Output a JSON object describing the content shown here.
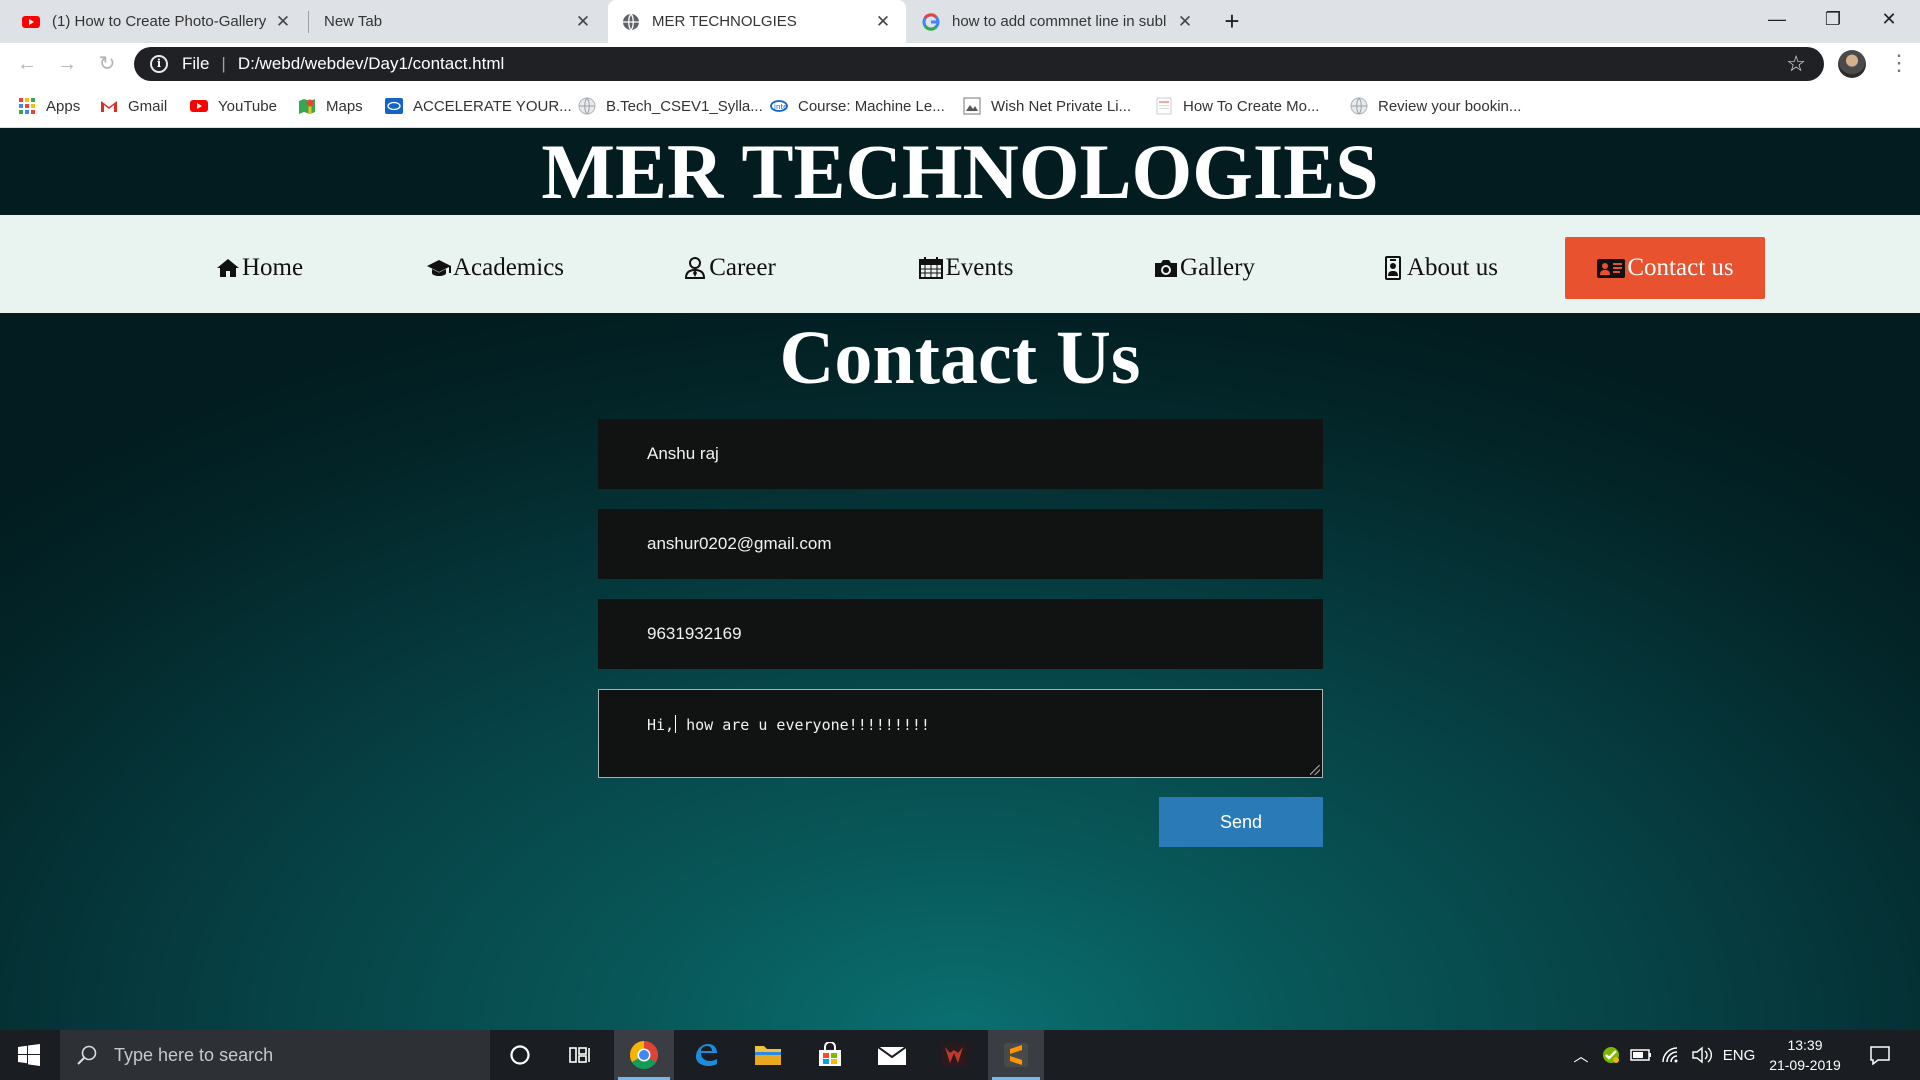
{
  "browser": {
    "tabs": [
      {
        "title": "(1) How to Create Photo-Gallery",
        "favicon": "youtube-icon",
        "active": false
      },
      {
        "title": "New Tab",
        "favicon": "none",
        "active": false
      },
      {
        "title": "MER TECHNOLGIES",
        "favicon": "globe-icon",
        "active": true
      },
      {
        "title": "how to add commnet line in subl",
        "favicon": "google-icon",
        "active": false
      }
    ],
    "new_tab_label": "+",
    "address": {
      "scheme": "File",
      "url": "D:/webd/webdev/Day1/contact.html"
    },
    "bookmarks": [
      {
        "label": "Apps",
        "icon": "apps-grid-icon"
      },
      {
        "label": "Gmail",
        "icon": "gmail-icon"
      },
      {
        "label": "YouTube",
        "icon": "youtube-icon"
      },
      {
        "label": "Maps",
        "icon": "maps-icon"
      },
      {
        "label": "ACCELERATE YOUR...",
        "icon": "intel-icon"
      },
      {
        "label": "B.Tech_CSEV1_Sylla...",
        "icon": "globe-icon"
      },
      {
        "label": "Course: Machine Le...",
        "icon": "intel-icon"
      },
      {
        "label": "Wish Net Private Li...",
        "icon": "image-icon"
      },
      {
        "label": "How To Create Mo...",
        "icon": "page-icon"
      },
      {
        "label": "Review your bookin...",
        "icon": "globe-icon"
      }
    ]
  },
  "site": {
    "brand": "MER TECHNOLOGIES",
    "nav": [
      {
        "label": "Home",
        "icon": "home-icon",
        "active": false
      },
      {
        "label": "Academics",
        "icon": "graduation-cap-icon",
        "active": false
      },
      {
        "label": "Career",
        "icon": "user-tie-icon",
        "active": false
      },
      {
        "label": "Events",
        "icon": "calendar-icon",
        "active": false
      },
      {
        "label": "Gallery",
        "icon": "camera-icon",
        "active": false
      },
      {
        "label": "About us",
        "icon": "id-badge-icon",
        "active": false
      },
      {
        "label": "Contact us",
        "icon": "address-card-icon",
        "active": true
      }
    ],
    "accent_color": "#e8522f",
    "heading": "Contact Us",
    "form": {
      "name": "Anshu raj",
      "email": "anshur0202@gmail.com",
      "phone": "9631932169",
      "message_before_caret": "Hi,",
      "message_after_caret": " how are u everyone!!!!!!!!!",
      "send_label": "Send",
      "send_color": "#2a7ab8"
    }
  },
  "taskbar": {
    "search_placeholder": "Type here to search",
    "language": "ENG",
    "time": "13:39",
    "date": "21-09-2019"
  }
}
